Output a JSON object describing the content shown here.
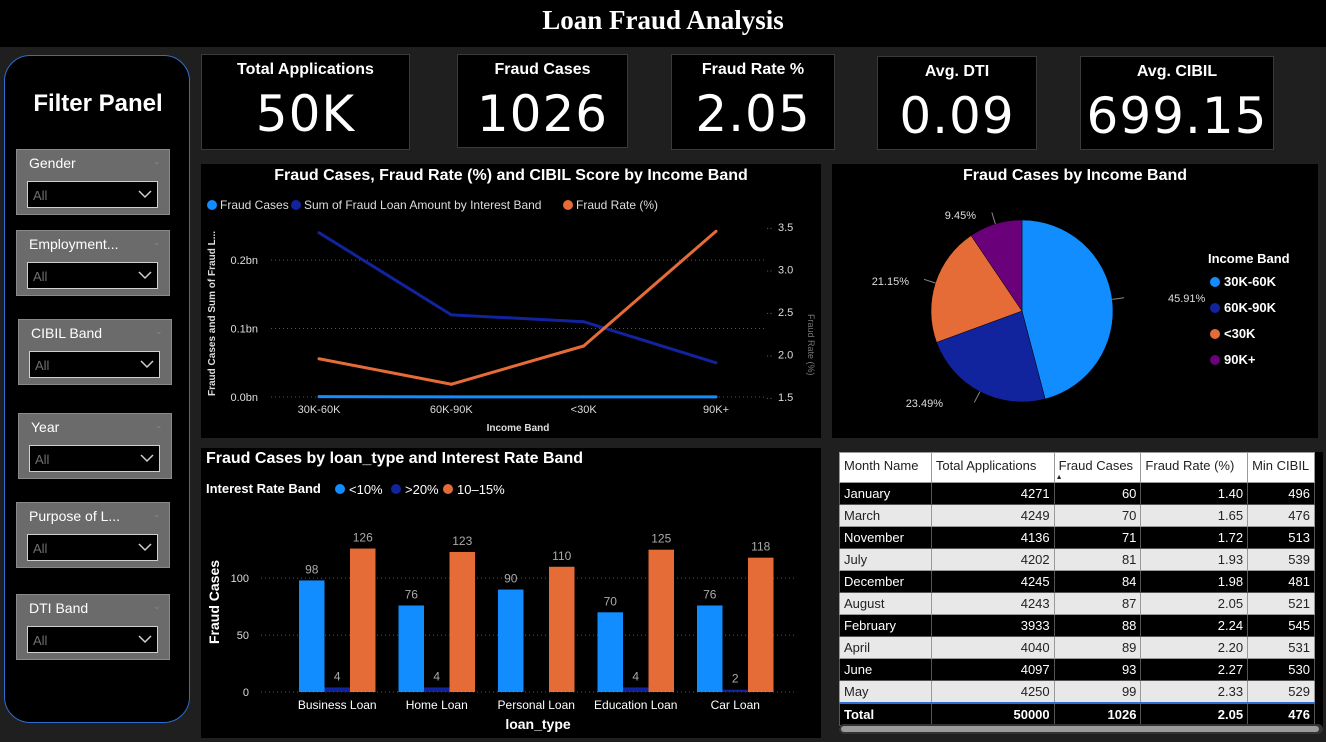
{
  "page": {
    "title": "Loan Fraud Analysis"
  },
  "filter_panel": {
    "title": "Filter Panel",
    "slicers": [
      {
        "label": "Gender",
        "value": "All"
      },
      {
        "label": "Employment...",
        "value": "All"
      },
      {
        "label": "CIBIL Band",
        "value": "All"
      },
      {
        "label": "Year",
        "value": "All"
      },
      {
        "label": "Purpose of L...",
        "value": "All"
      },
      {
        "label": "DTI Band",
        "value": "All"
      }
    ]
  },
  "kpis": [
    {
      "label": "Total Applications",
      "value": "50K"
    },
    {
      "label": "Fraud Cases",
      "value": "1026"
    },
    {
      "label": "Fraud Rate %",
      "value": "2.05"
    },
    {
      "label": "Avg. DTI",
      "value": "0.09"
    },
    {
      "label": "Avg. CIBIL",
      "value": "699.15"
    }
  ],
  "colors": {
    "blue": "#118dff",
    "navy": "#12239e",
    "orange": "#e66c37",
    "purple": "#6b007b",
    "panel_border": "#2f6dd0"
  },
  "combo_chart": {
    "title": "Fraud Cases, Fraud Rate (%) and CIBIL Score by Income Band",
    "legend": [
      "Fraud Cases",
      "Sum of Fraud Loan Amount by Interest Band",
      "Fraud Rate (%)"
    ],
    "xlabel": "Income Band",
    "ylabel": "Fraud Cases and Sum of Fraud L...",
    "y2label": "Fraud Rate (%)",
    "y_ticks": [
      "0.0bn",
      "0.1bn",
      "0.2bn"
    ],
    "y2_ticks": [
      "1.5",
      "2.0",
      "2.5",
      "3.0",
      "3.5"
    ]
  },
  "pie_chart": {
    "title": "Fraud Cases by Income Band",
    "legend_title": "Income Band",
    "labels": [
      "45.91%",
      "23.49%",
      "21.15%",
      "9.45%"
    ]
  },
  "bar_chart": {
    "title": "Fraud Cases by loan_type and Interest Rate Band",
    "legend_title": "Interest Rate Band",
    "legend": [
      "<10%",
      ">20%",
      "10–15%"
    ],
    "xlabel": "loan_type",
    "ylabel": "Fraud Cases",
    "y_ticks": [
      "0",
      "50",
      "100"
    ]
  },
  "chart_data": [
    {
      "type": "line",
      "title": "Fraud Cases, Fraud Rate (%) and CIBIL Score by Income Band",
      "categories": [
        "30K-60K",
        "60K-90K",
        "<30K",
        "90K+"
      ],
      "xlabel": "Income Band",
      "ylabel": "Fraud Cases and Sum of Fraud L...",
      "y2label": "Fraud Rate (%)",
      "ylim": [
        0,
        0.26
      ],
      "y2lim": [
        1.5,
        3.5
      ],
      "series": [
        {
          "name": "Fraud Cases",
          "axis": "y",
          "values": [
            0.0005,
            0.0002,
            0.0002,
            0.0001
          ]
        },
        {
          "name": "Sum of Fraud Loan Amount by Interest Band",
          "axis": "y",
          "values": [
            0.24,
            0.12,
            0.11,
            0.05
          ]
        },
        {
          "name": "Fraud Rate (%)",
          "axis": "y2",
          "values": [
            1.95,
            1.65,
            2.1,
            3.45
          ]
        }
      ],
      "grid": true,
      "legend_position": "top-left"
    },
    {
      "type": "pie",
      "title": "Fraud Cases by Income Band",
      "categories": [
        "30K-60K",
        "60K-90K",
        "<30K",
        "90K+"
      ],
      "values": [
        45.91,
        23.49,
        21.15,
        9.45
      ],
      "legend_position": "right"
    },
    {
      "type": "bar",
      "title": "Fraud Cases by loan_type and Interest Rate Band",
      "categories": [
        "Business Loan",
        "Home Loan",
        "Personal Loan",
        "Education Loan",
        "Car Loan"
      ],
      "xlabel": "loan_type",
      "ylabel": "Fraud Cases",
      "ylim": [
        0,
        130
      ],
      "series": [
        {
          "name": "<10%",
          "values": [
            98,
            76,
            90,
            70,
            76
          ]
        },
        {
          "name": ">20%",
          "values": [
            4,
            4,
            0,
            4,
            2
          ]
        },
        {
          "name": "10–15%",
          "values": [
            126,
            123,
            110,
            125,
            118
          ]
        }
      ],
      "grid": true,
      "legend_position": "top-left"
    }
  ],
  "table": {
    "columns": [
      "Month Name",
      "Total Applications",
      "Fraud Cases",
      "Fraud Rate (%)",
      "Min CIBIL"
    ],
    "rows": [
      [
        "January",
        "4271",
        "60",
        "1.40",
        "496"
      ],
      [
        "March",
        "4249",
        "70",
        "1.65",
        "476"
      ],
      [
        "November",
        "4136",
        "71",
        "1.72",
        "513"
      ],
      [
        "July",
        "4202",
        "81",
        "1.93",
        "539"
      ],
      [
        "December",
        "4245",
        "84",
        "1.98",
        "481"
      ],
      [
        "August",
        "4243",
        "87",
        "2.05",
        "521"
      ],
      [
        "February",
        "3933",
        "88",
        "2.24",
        "545"
      ],
      [
        "April",
        "4040",
        "89",
        "2.20",
        "531"
      ],
      [
        "June",
        "4097",
        "93",
        "2.27",
        "530"
      ],
      [
        "May",
        "4250",
        "99",
        "2.33",
        "529"
      ]
    ],
    "total": [
      "Total",
      "50000",
      "1026",
      "2.05",
      "476"
    ]
  }
}
